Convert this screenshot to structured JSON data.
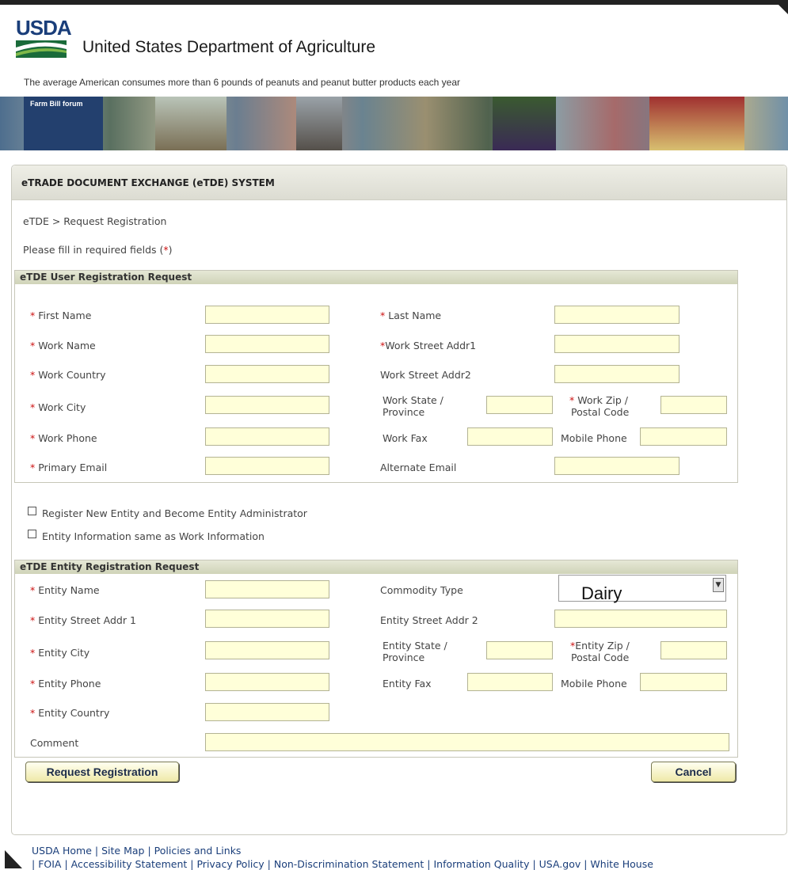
{
  "header": {
    "logo_text": "USDA",
    "agency_name": "United States Department of Agriculture",
    "fact": "The average American consumes more than 6 pounds of peanuts and peanut butter products each year",
    "banner_badge": "Farm Bill forum"
  },
  "panel": {
    "title": "eTRADE DOCUMENT EXCHANGE (eTDE) SYSTEM",
    "breadcrumb": "eTDE > Request Registration",
    "instructions_prefix": "Please fill in required fields (",
    "instructions_star": "*",
    "instructions_suffix": ")"
  },
  "user_section": {
    "title": "eTDE User Registration Request",
    "first_name": "First Name",
    "last_name": "Last Name",
    "work_name": "Work Name",
    "work_street1": "Work Street Addr1",
    "work_country": "Work Country",
    "work_street2": "Work Street Addr2",
    "work_city": "Work City",
    "work_state_1": "Work State /",
    "work_state_2": "Province",
    "work_zip_1": "Work Zip /",
    "work_zip_2": "Postal Code",
    "work_phone": "Work Phone",
    "work_fax": "Work Fax",
    "mobile_phone": "Mobile Phone",
    "primary_email": "Primary Email",
    "alternate_email": "Alternate Email"
  },
  "options": {
    "register_entity": "Register New Entity and Become Entity Administrator",
    "same_as_work": "Entity Information same as Work Information"
  },
  "entity_section": {
    "title": "eTDE Entity Registration Request",
    "entity_name": "Entity Name",
    "commodity_type": "Commodity Type",
    "commodity_value": "Dairy",
    "entity_street1": "Entity Street Addr 1",
    "entity_street2": "Entity Street Addr 2",
    "entity_city": "Entity City",
    "entity_state_1": "Entity State /",
    "entity_state_2": "Province",
    "entity_zip_1": "Entity Zip /",
    "entity_zip_2": "Postal Code",
    "entity_phone": "Entity Phone",
    "entity_fax": "Entity Fax",
    "mobile_phone": "Mobile Phone",
    "entity_country": "Entity Country",
    "comment": "Comment"
  },
  "buttons": {
    "request": "Request Registration",
    "cancel": "Cancel"
  },
  "footer": {
    "line1": [
      "USDA Home",
      "Site Map",
      "Policies and Links"
    ],
    "line2": [
      "FOIA",
      "Accessibility Statement",
      "Privacy Policy",
      "Non-Discrimination Statement",
      "Information Quality",
      "USA.gov",
      "White House"
    ]
  }
}
